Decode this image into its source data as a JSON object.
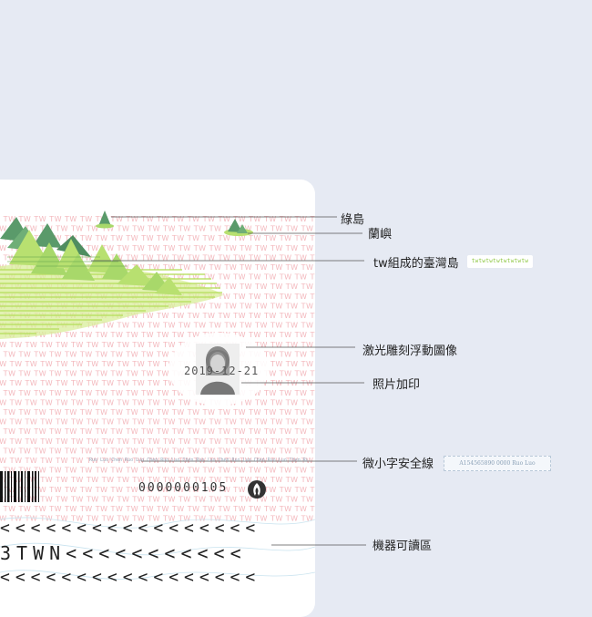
{
  "labels": {
    "green_island": "綠島",
    "orchid_island": "蘭嶼",
    "taiwan_island": "tw組成的臺灣島",
    "laser_image": "激光雕刻浮動圖像",
    "photo_print": "照片加印",
    "micro_text": "微小字安全線",
    "mrz": "機器可讀區"
  },
  "samples": {
    "tw_sample": "twtwtwtwtwtwtwtw",
    "micro_sample": "A154565890 0000 Ruo Luo"
  },
  "card": {
    "tw_word": "TW",
    "photo_date": "2019-12-21",
    "serial": "0000000105",
    "micro_line": "Ruo Luo Chen Ruo Luo Chen Ruo Luo Chen Ruo Luo Chen Ruo Luo Chen Ruo Luo Chen Ruo Luo Chen",
    "mrz_line1": "<<<<<<<<<<<<<<<<<",
    "mrz_line2": "3TWN<<<<<<<<<<<",
    "mrz_line3": "<<<<<<<<<<<<<<<<<"
  },
  "colors": {
    "background": "#e6eaf3",
    "tw_pattern": "#f3b8bd",
    "island_green": "#a8d86a",
    "mountain_dark": "#5a9a6a",
    "mountain_light": "#b8e070",
    "leader_line": "#555555"
  },
  "icons": {
    "emblem": "flame-emblem-icon",
    "barcode": "barcode-icon",
    "portrait": "portrait-photo"
  }
}
